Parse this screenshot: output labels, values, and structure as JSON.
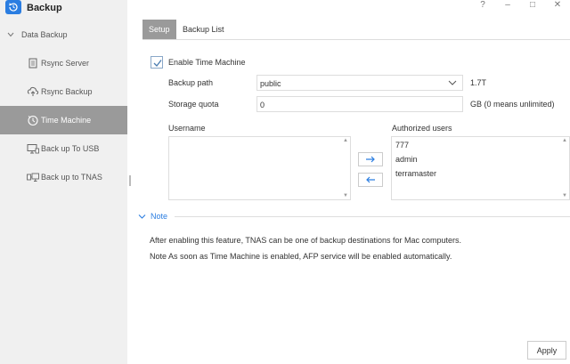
{
  "app": {
    "title": "Backup",
    "icon": "backup-restore-icon"
  },
  "window_controls": {
    "help": "?",
    "minimize": "–",
    "maximize": "□",
    "close": "✕"
  },
  "sidebar": {
    "group": "Data Backup",
    "items": [
      {
        "label": "Rsync Server",
        "icon": "rsync-server-icon"
      },
      {
        "label": "Rsync Backup",
        "icon": "rsync-backup-icon"
      },
      {
        "label": "Time Machine",
        "icon": "time-machine-icon",
        "active": true
      },
      {
        "label": "Back up To USB",
        "icon": "usb-backup-icon"
      },
      {
        "label": "Back up to TNAS",
        "icon": "tnas-backup-icon"
      }
    ]
  },
  "tabs": [
    {
      "label": "Setup",
      "active": true
    },
    {
      "label": "Backup List",
      "active": false
    }
  ],
  "form": {
    "enable_label": "Enable Time Machine",
    "enabled": true,
    "backup_path_label": "Backup path",
    "backup_path_value": "public",
    "backup_path_size": "1.7T",
    "quota_label": "Storage quota",
    "quota_value": "0",
    "quota_unit": "GB (0 means unlimited)"
  },
  "users": {
    "username_header": "Username",
    "authorized_header": "Authorized users",
    "available": [],
    "authorized": [
      "777",
      "admin",
      "terramaster"
    ]
  },
  "note": {
    "title": "Note",
    "lines": [
      "After enabling this feature, TNAS can be one of backup destinations for Mac computers.",
      "Note As soon as Time Machine is enabled, AFP service will be enabled automatically."
    ]
  },
  "apply_label": "Apply",
  "colors": {
    "accent": "#2a7de1",
    "active_bg": "#9a9a9a",
    "sidebar_bg": "#f0f0f0"
  }
}
